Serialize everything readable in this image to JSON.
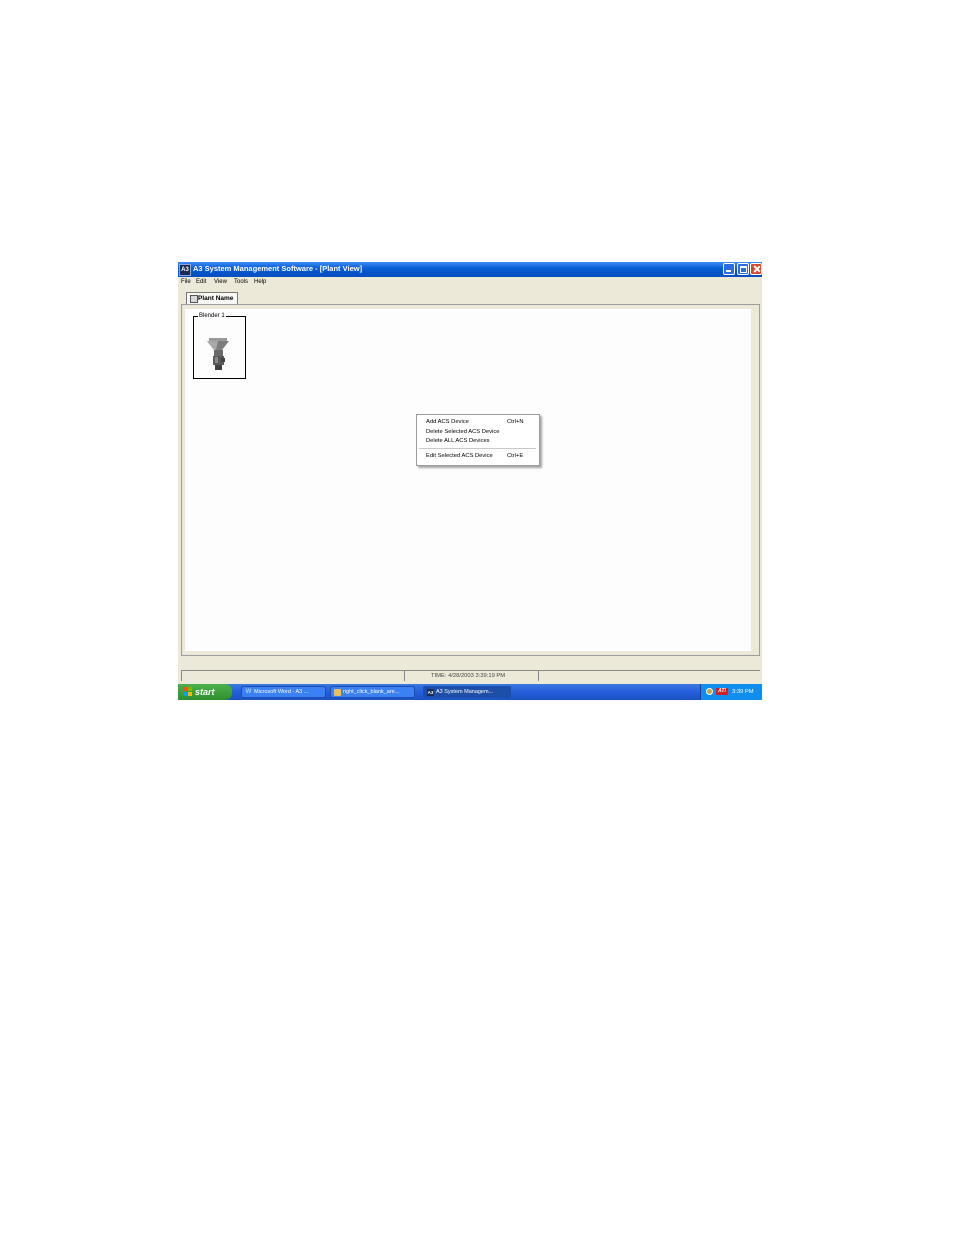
{
  "window": {
    "icon_text": "A3",
    "title": "A3 System Management Software - [Plant View]"
  },
  "menu": [
    "File",
    "Edit",
    "View",
    "Tools",
    "Help"
  ],
  "tab": {
    "label": "Plant Name"
  },
  "device": {
    "label": "Blender 1"
  },
  "context_menu": {
    "items": [
      {
        "label": "Add ACS Device",
        "shortcut": "Ctrl+N"
      },
      {
        "label": "Delete Selected ACS Device",
        "shortcut": ""
      },
      {
        "label": "Delete ALL ACS Devices",
        "shortcut": ""
      },
      {
        "label": "Edit Selected ACS Device",
        "shortcut": "Ctrl+E"
      }
    ]
  },
  "status": {
    "time": "TIME:  4/28/2003 3:39:19 PM"
  },
  "taskbar": {
    "start_label": "start",
    "tasks": [
      {
        "label": "Microsoft Word - A3 ...",
        "icon": "W"
      },
      {
        "label": "right_click_blank_are...",
        "icon": ""
      },
      {
        "label": "A3 System Managem...",
        "icon": "A3"
      }
    ],
    "tray_badge": "ATI",
    "clock": "3:39 PM"
  },
  "colors": {
    "titlebar": "#0553c8",
    "taskbar": "#245edb",
    "start": "#3a9d3a",
    "close": "#d9462a"
  }
}
